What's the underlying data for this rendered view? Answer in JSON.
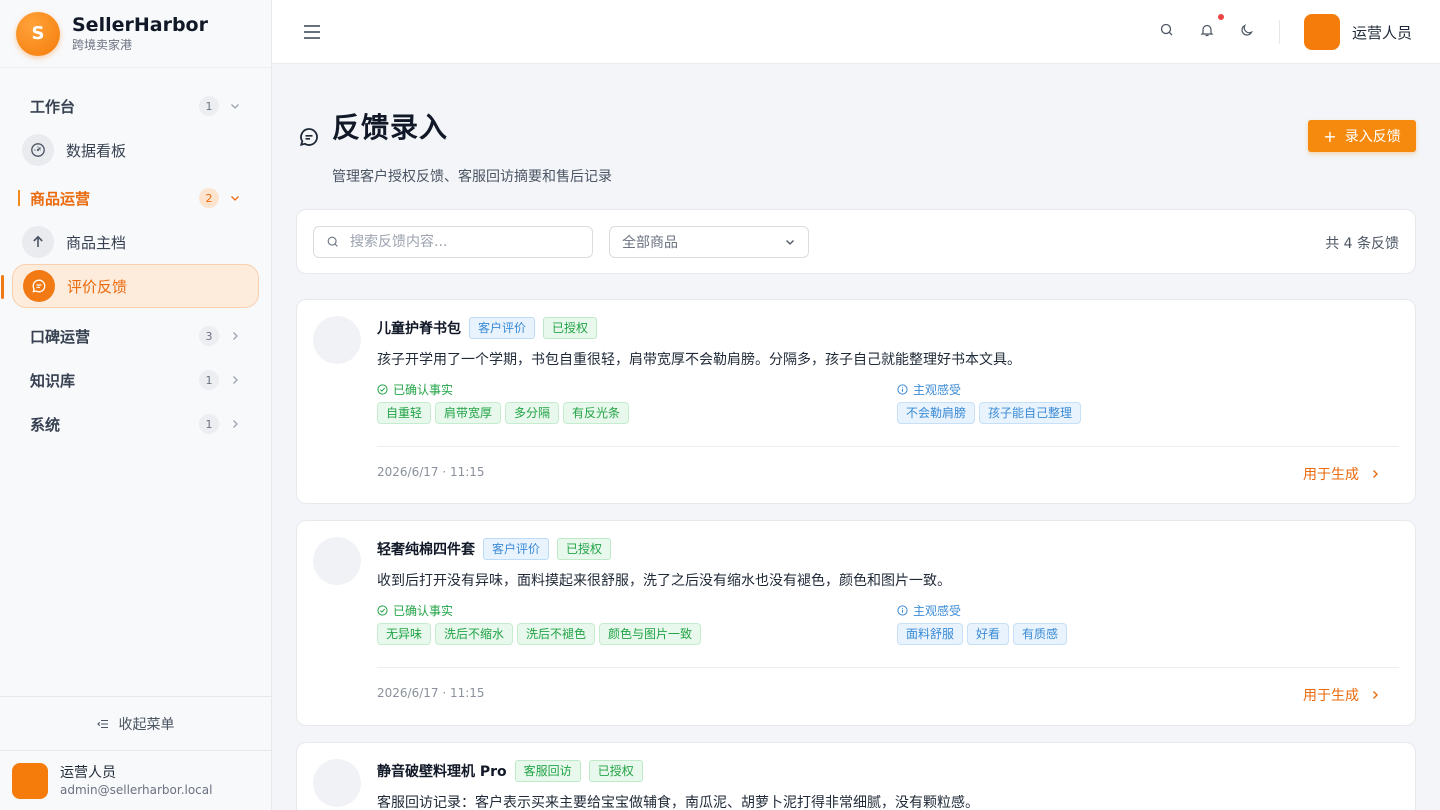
{
  "brand": {
    "logo_letter": "S",
    "name": "SellerHarbor",
    "subtitle": "跨境卖家港"
  },
  "sidebar": {
    "groups": [
      {
        "label": "工作台",
        "count": "1",
        "expanded": true,
        "items": [
          {
            "label": "数据看板",
            "icon": "dashboard-icon"
          }
        ]
      },
      {
        "label": "商品运营",
        "count": "2",
        "expanded": true,
        "active": true,
        "items": [
          {
            "label": "商品主档",
            "icon": "arrow-up-icon"
          },
          {
            "label": "评价反馈",
            "icon": "chat-icon",
            "active": true
          }
        ]
      },
      {
        "label": "口碑运营",
        "count": "3",
        "expanded": false
      },
      {
        "label": "知识库",
        "count": "1",
        "expanded": false
      },
      {
        "label": "系统",
        "count": "1",
        "expanded": false
      }
    ],
    "collapse_label": "收起菜单",
    "user": {
      "avatar_glyph": "",
      "name": "运营人员",
      "email": "admin@sellerharbor.local"
    }
  },
  "topbar": {
    "icons": [
      "menu-icon",
      "search-icon",
      "bell-icon",
      "moon-icon"
    ],
    "notification_dot_color": "#ef4444",
    "avatar_glyph": "",
    "user_name": "运营人员"
  },
  "page": {
    "title": "反馈录入",
    "subtitle": "管理客户授权反馈、客服回访摘要和售后记录",
    "add_button": "录入反馈",
    "accent_color": "#f58a0f"
  },
  "filters": {
    "search_placeholder": "搜索反馈内容...",
    "product_select": "全部商品",
    "total_text": "共 4 条反馈"
  },
  "labels": {
    "facts_title": "已确认事实",
    "feelings_title": "主观感受",
    "use_link": "用于生成"
  },
  "feedbacks": [
    {
      "icon_glyph": "",
      "product": "儿童护脊书包",
      "source_tag": "客户评价",
      "auth_tag": "已授权",
      "content": "孩子开学用了一个学期，书包自重很轻，肩带宽厚不会勒肩膀。分隔多，孩子自己就能整理好书本文具。",
      "facts": [
        "自重轻",
        "肩带宽厚",
        "多分隔",
        "有反光条"
      ],
      "feelings": [
        "不会勒肩膀",
        "孩子能自己整理"
      ],
      "time": "2026/6/17 · 11:15"
    },
    {
      "icon_glyph": "",
      "product": "轻奢纯棉四件套",
      "source_tag": "客户评价",
      "auth_tag": "已授权",
      "content": "收到后打开没有异味，面料摸起来很舒服，洗了之后没有缩水也没有褪色，颜色和图片一致。",
      "facts": [
        "无异味",
        "洗后不缩水",
        "洗后不褪色",
        "颜色与图片一致"
      ],
      "feelings": [
        "面料舒服",
        "好看",
        "有质感"
      ],
      "time": "2026/6/17 · 11:15"
    },
    {
      "icon_glyph": "",
      "product": "静音破壁料理机 Pro",
      "source_tag": "客服回访",
      "auth_tag": "已授权",
      "content": "客服回访记录：客户表示买来主要给宝宝做辅食，南瓜泥、胡萝卜泥打得非常细腻，没有颗粒感。",
      "facts": [],
      "feelings": [],
      "time": ""
    }
  ]
}
